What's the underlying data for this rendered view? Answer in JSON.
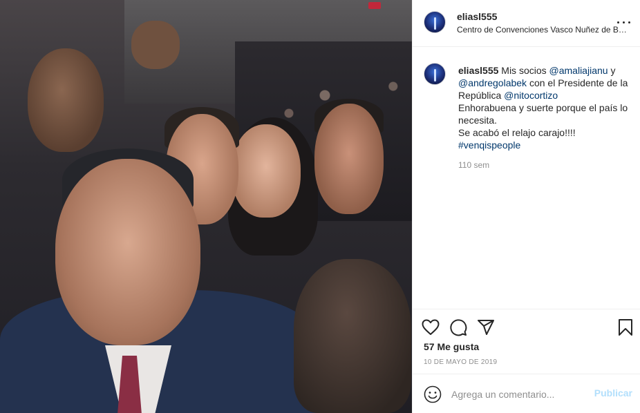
{
  "header": {
    "username": "eliasl555",
    "location": "Centro de Convenciones Vasco Nuñez de Balboa"
  },
  "caption": {
    "username": "eliasl555",
    "text_1": " Mis socios ",
    "mention_1": "@amaliajianu",
    "text_2": " y ",
    "mention_2": "@andregolabek",
    "text_3": " con el Presidente de la República ",
    "mention_3": "@nitocortizo",
    "line_2": "Enhorabuena y suerte porque el país lo necesita.",
    "line_3": "Se acabó el relajo carajo!!!!",
    "hashtag": "#venqispeople",
    "time_ago": "110 sem"
  },
  "actions": {
    "like_icon": "heart-icon",
    "comment_icon": "comment-icon",
    "share_icon": "send-icon",
    "save_icon": "bookmark-icon",
    "likes": "57 Me gusta",
    "date": "10 DE MAYO DE 2019"
  },
  "add_comment": {
    "placeholder": "Agrega un comentario...",
    "post_label": "Publicar",
    "emoji_icon": "emoji-icon"
  },
  "colors": {
    "link": "#00376b",
    "post_button_disabled": "#b2dffc",
    "muted": "#8e8e8e",
    "border": "#efefef"
  }
}
